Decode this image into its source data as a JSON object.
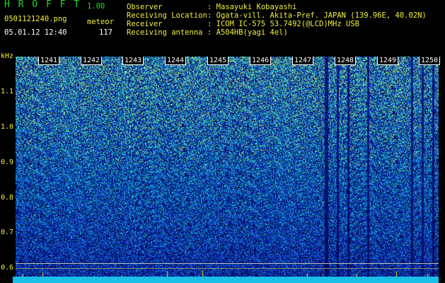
{
  "header": {
    "app_title": "H R O F F T",
    "version": "1.00",
    "filename": "0501121240.png",
    "mode": "meteor",
    "datetime": "05.01.12 12:40",
    "count": "117"
  },
  "info": {
    "rows": [
      {
        "key": "Observer",
        "value": ": Masayuki Kobayashi"
      },
      {
        "key": "Receiving Location",
        "value": ": Ogata-vill. Akita-Pref. JAPAN (139.96E, 40.02N)"
      },
      {
        "key": "Receiver",
        "value": ": ICOM IC-575 53.7492(@LCD)MHz USB"
      },
      {
        "key": "Receiving antenna",
        "value": ": A504HB(yagi 4el)"
      }
    ]
  },
  "axis": {
    "unit": "kHz",
    "y_labels": [
      "1.1",
      "1.0",
      "0.9",
      "0.8",
      "0.7",
      "0.6"
    ],
    "time_ticks": [
      "1241",
      "1242",
      "1243",
      "1244",
      "1245",
      "1246",
      "1247",
      "1248",
      "1249",
      "1250"
    ]
  },
  "colors": {
    "background": "#000000",
    "title_green": "#22dd22",
    "label_yellow": "#f2ef3a",
    "baseline_cyan": "#19bfe6",
    "spectrum_low": "#0a1a9e",
    "spectrum_high": "#2ad0c0"
  }
}
